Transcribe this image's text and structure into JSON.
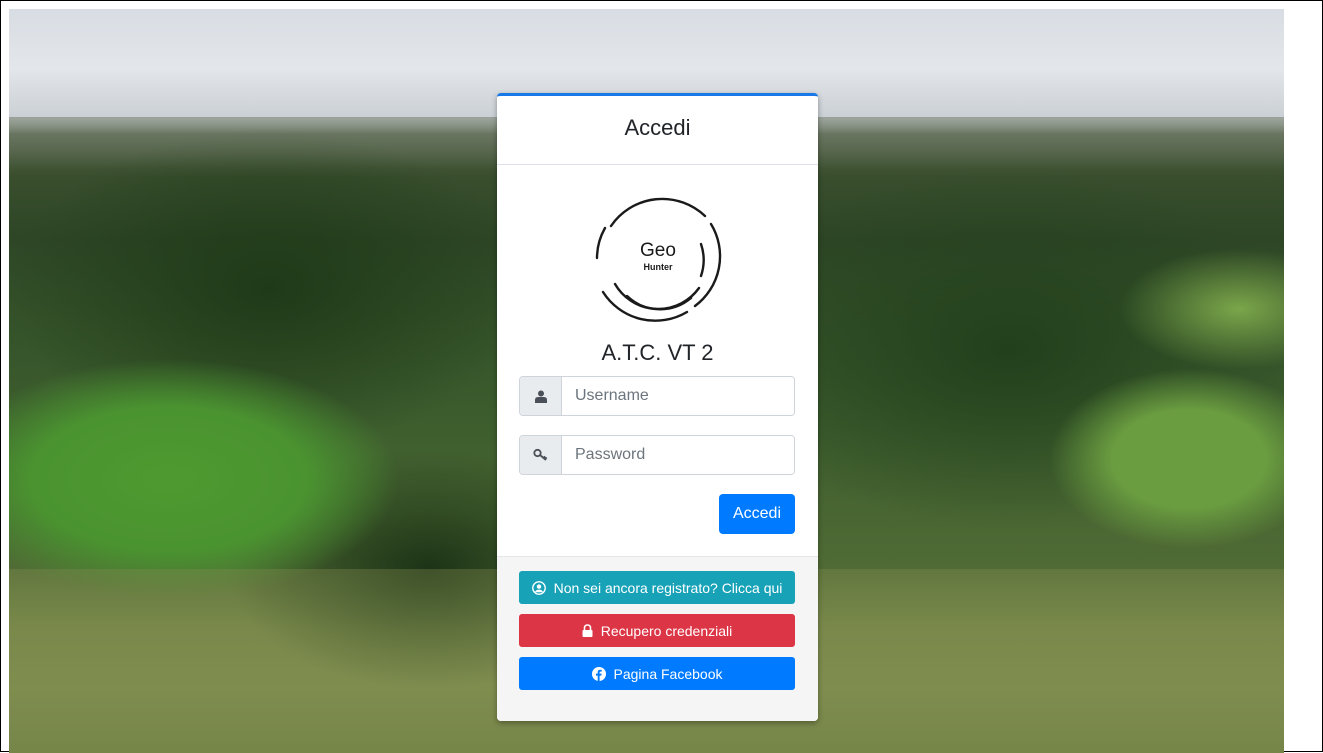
{
  "card": {
    "title": "Accedi",
    "org_name": "A.T.C. VT 2",
    "logo": {
      "line1": "Geo",
      "line2": "Hunter"
    }
  },
  "form": {
    "username_placeholder": "Username",
    "password_placeholder": "Password",
    "submit_label": "Accedi"
  },
  "footer": {
    "register_label": "Non sei ancora registrato? Clicca qui",
    "recover_label": "Recupero credenziali",
    "facebook_label": "Pagina Facebook"
  },
  "icons": {
    "username": "user-icon",
    "password": "key-icon",
    "register": "user-circle-icon",
    "recover": "lock-icon",
    "facebook": "facebook-icon"
  },
  "colors": {
    "primary": "#007bff",
    "info": "#17a2b8",
    "danger": "#dc3545",
    "card_top_border": "#1878e8"
  }
}
